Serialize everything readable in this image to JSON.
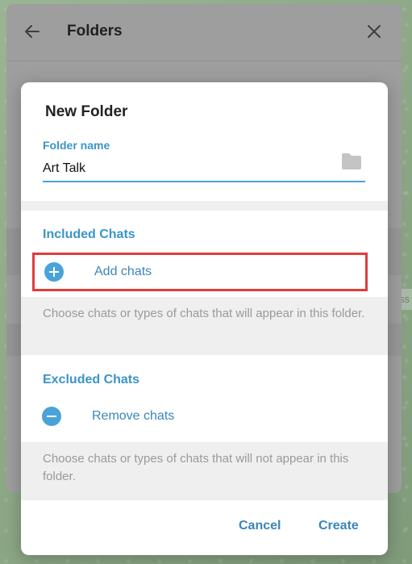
{
  "background": {
    "edge_text": "ss"
  },
  "folders_panel": {
    "title": "Folders",
    "back_icon": "arrow-left-icon",
    "close_icon": "close-icon"
  },
  "dialog": {
    "title": "New Folder",
    "folder_name": {
      "label": "Folder name",
      "value": "Art Talk",
      "icon": "folder-icon"
    },
    "included": {
      "title": "Included Chats",
      "action_label": "Add chats",
      "action_icon": "plus-circle-icon",
      "hint": "Choose chats or types of chats that will appear in this folder."
    },
    "excluded": {
      "title": "Excluded Chats",
      "action_label": "Remove chats",
      "action_icon": "minus-circle-icon",
      "hint": "Choose chats or types of chats that will not appear in this folder."
    },
    "buttons": {
      "cancel": "Cancel",
      "create": "Create"
    }
  },
  "colors": {
    "accent": "#3a95c9",
    "highlight_box": "#e23c3c"
  }
}
